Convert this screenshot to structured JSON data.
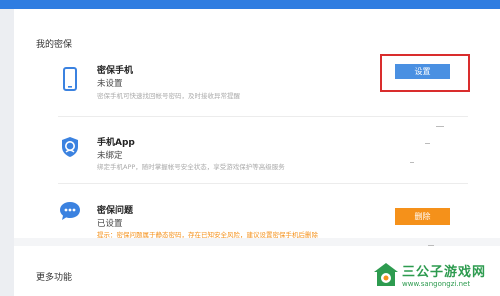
{
  "page": {
    "section_title": "我的密保",
    "more_title": "更多功能"
  },
  "items": [
    {
      "name": "phone",
      "title": "密保手机",
      "status": "未设置",
      "desc": "密保手机可快速找回帐号密码，及时接收异常提醒",
      "action": "设置",
      "icon": "phone-icon"
    },
    {
      "name": "app",
      "title": "手机App",
      "status": "未绑定",
      "desc": "绑定手机APP，随时掌握帐号安全状态，享受游戏保护等高级服务",
      "icon": "shield-icon"
    },
    {
      "name": "question",
      "title": "密保问题",
      "status": "已设置",
      "desc": "提示：密保问题属于静态密码，存在已知安全风险，建议设置密保手机后删除",
      "action": "删除",
      "icon": "chat-bubble-icon"
    }
  ],
  "watermark": {
    "title": "三公子游戏网",
    "url": "www.sangongzi.net"
  },
  "colors": {
    "topbar": "#2f7de1",
    "button_blue": "#4a90e2",
    "button_orange": "#f5911a",
    "highlight": "#d92d2d",
    "icon_blue": "#3b82e0",
    "watermark_green": "#2d9b4f"
  }
}
